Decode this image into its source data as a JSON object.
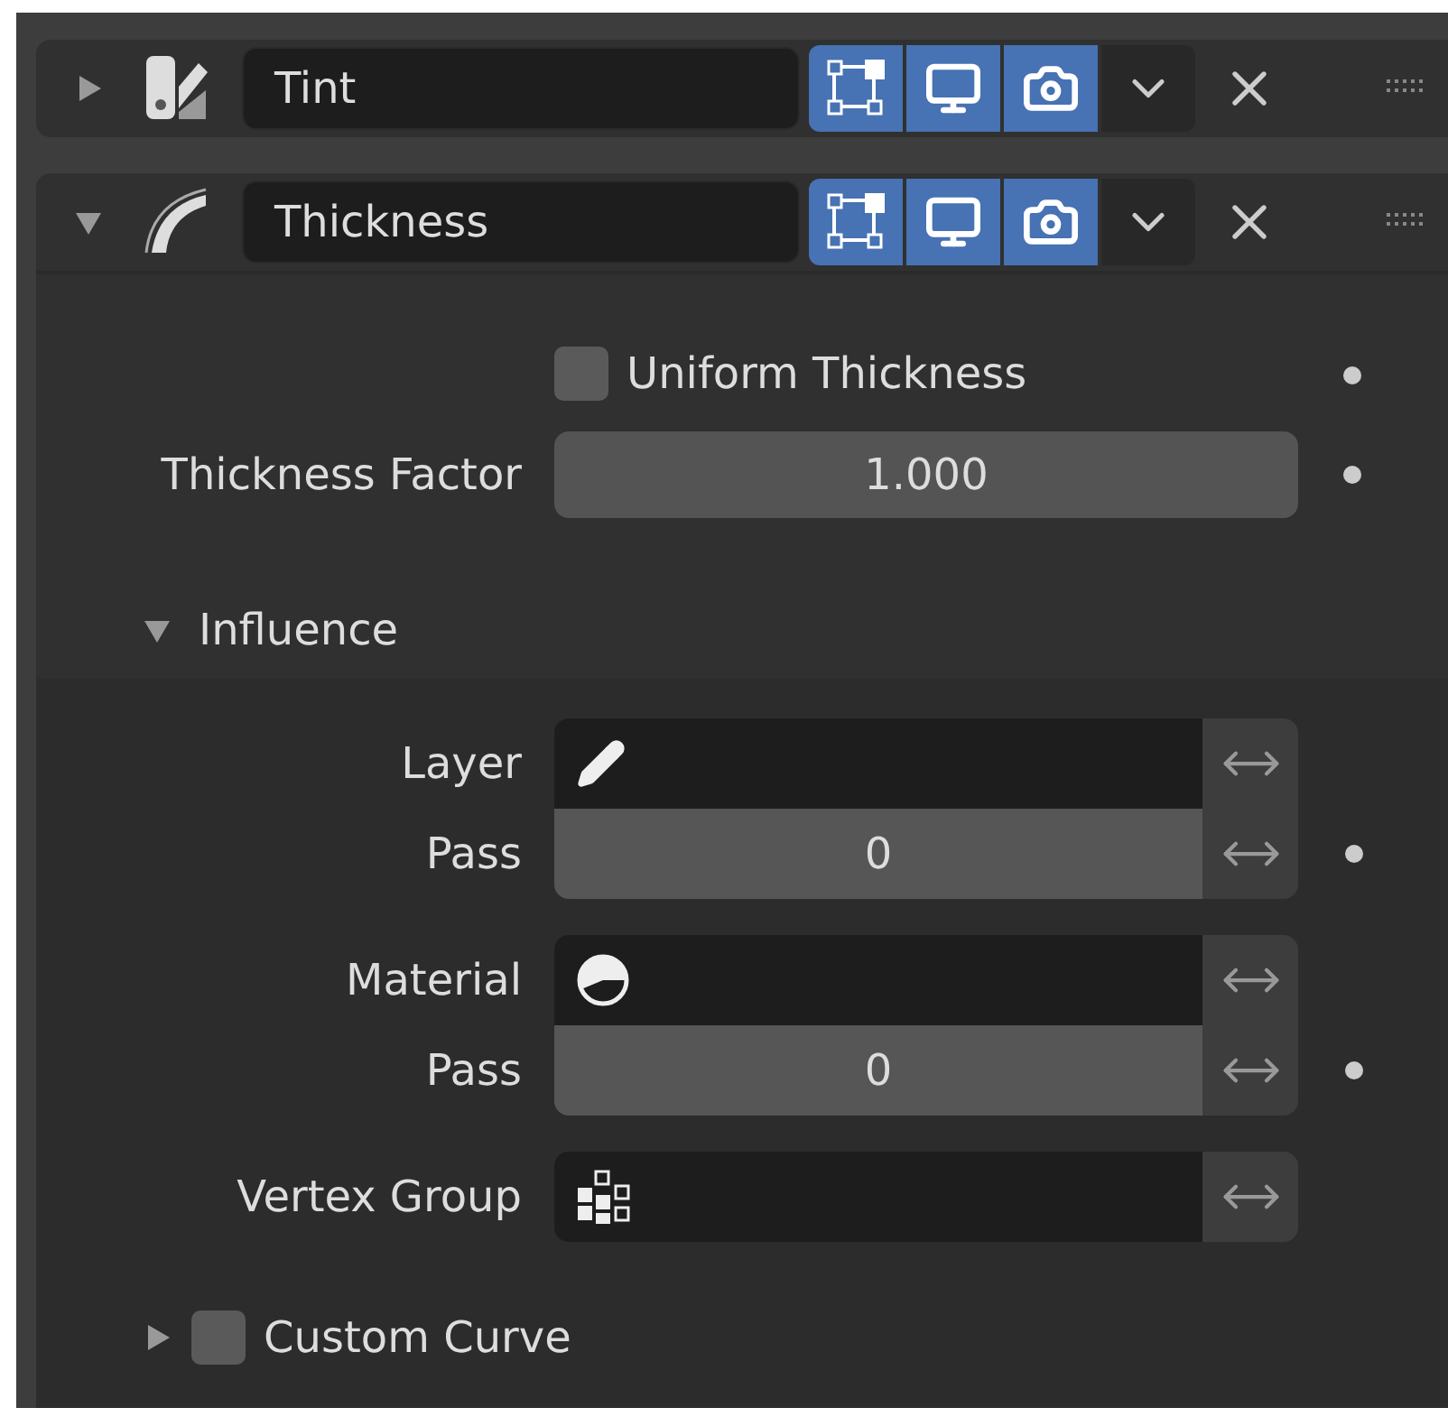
{
  "modifiers": [
    {
      "kind": "tint",
      "name": "Tint",
      "expanded": false,
      "toggles": [
        {
          "kind": "edit_mode",
          "on": true
        },
        {
          "kind": "viewport",
          "on": true
        },
        {
          "kind": "render",
          "on": true
        }
      ]
    },
    {
      "kind": "thickness",
      "name": "Thickness",
      "expanded": true,
      "toggles": [
        {
          "kind": "edit_mode",
          "on": true
        },
        {
          "kind": "viewport",
          "on": true
        },
        {
          "kind": "render",
          "on": true
        }
      ]
    }
  ],
  "settings": {
    "uniform_thickness": {
      "label": "Uniform Thickness",
      "checked": false,
      "animatable": true
    },
    "thickness_factor": {
      "label": "Thickness Factor",
      "value": "1.000",
      "animatable": true
    }
  },
  "influence": {
    "label": "Influence",
    "expanded": true,
    "groups": [
      {
        "rows": [
          {
            "kind": "layer",
            "label": "Layer",
            "value": "",
            "inverted": false,
            "animatable": false
          },
          {
            "kind": "number",
            "label": "Pass",
            "value": "0",
            "inverted": false,
            "animatable": true
          }
        ]
      },
      {
        "rows": [
          {
            "kind": "material",
            "label": "Material",
            "value": "",
            "inverted": false,
            "animatable": false
          },
          {
            "kind": "number",
            "label": "Pass",
            "value": "0",
            "inverted": false,
            "animatable": true
          }
        ]
      },
      {
        "rows": [
          {
            "kind": "vertex_group",
            "label": "Vertex Group",
            "value": "",
            "inverted": false,
            "animatable": false
          }
        ]
      }
    ]
  },
  "custom_curve": {
    "label": "Custom Curve",
    "expanded": false,
    "checked": false
  }
}
